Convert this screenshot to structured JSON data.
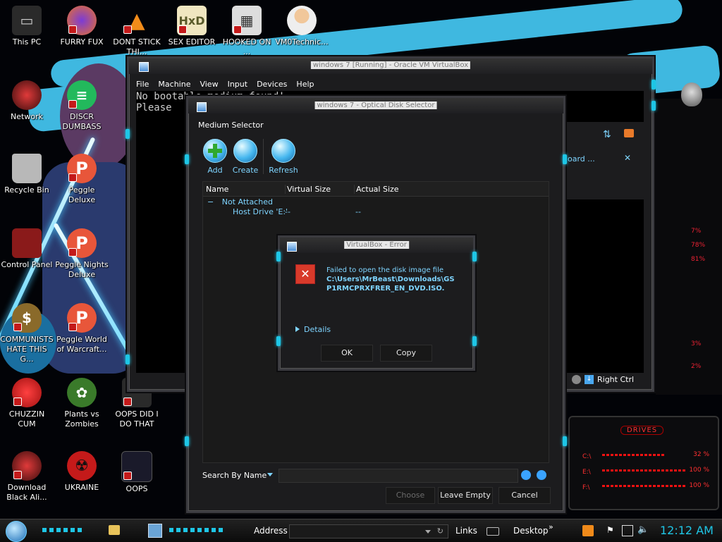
{
  "desktop": {
    "icons": [
      {
        "label": "This PC"
      },
      {
        "label": "FURRY FUX"
      },
      {
        "label": "DONT STICK THI..."
      },
      {
        "label": "SEX EDITOR"
      },
      {
        "label": "HOOKED ON ..."
      },
      {
        "label": "VM0Technic..."
      },
      {
        "label": "Network"
      },
      {
        "label": "DISCR DUMBASS"
      },
      {
        "label": "Recycle Bin"
      },
      {
        "label": "Peggle Deluxe"
      },
      {
        "label": "Control Panel"
      },
      {
        "label": "Peggle Nights Deluxe"
      },
      {
        "label": "COMMUNISTS HATE THIS G..."
      },
      {
        "label": "Peggle World of Warcraft..."
      },
      {
        "label": "CHUZZIN CUM"
      },
      {
        "label": "Plants vs Zombies"
      },
      {
        "label": "OOPS DID I DO THAT"
      },
      {
        "label": "Download Black Ali..."
      },
      {
        "label": "UKRAINE"
      },
      {
        "label": "OOPS"
      }
    ]
  },
  "vm_window": {
    "title": "windows 7 [Running] - Oracle VM VirtualBox",
    "menu": [
      "File",
      "Machine",
      "View",
      "Input",
      "Devices",
      "Help"
    ],
    "console_line1": "No bootable medium found!",
    "console_line2": "Please",
    "host_key": "Right Ctrl",
    "right_snippet": "oard ..."
  },
  "medium_selector": {
    "title": "windows 7 - Optical Disk Selector",
    "heading": "Medium Selector",
    "toolbar": {
      "add": "Add",
      "create": "Create",
      "refresh": "Refresh"
    },
    "columns": [
      "Name",
      "Virtual Size",
      "Actual Size"
    ],
    "group": "Not Attached",
    "group_toggle": "−",
    "row": {
      "name": "Host Drive 'E:'",
      "virtual_size": "--",
      "actual_size": "--"
    },
    "search_label": "Search By Name",
    "buttons": {
      "choose": "Choose",
      "leave_empty": "Leave Empty",
      "cancel": "Cancel"
    }
  },
  "error_dialog": {
    "title": "VirtualBox - Error",
    "message_prefix": "Failed to open the disk image file ",
    "message_path": "C:\\Users\\MrBeast\\Downloads\\GSP1RMCPRXFRER_EN_DVD.ISO.",
    "details": "Details",
    "ok": "OK",
    "copy": "Copy"
  },
  "gadget": {
    "stats": [
      "7%",
      "78%",
      "81%",
      "3%",
      "2%"
    ],
    "drives_title": "DRIVES",
    "drives": [
      {
        "label": "C:\\",
        "value": "32 %"
      },
      {
        "label": "E:\\",
        "value": "100 %"
      },
      {
        "label": "F:\\",
        "value": "100 %"
      }
    ]
  },
  "taskbar": {
    "address_label": "Address",
    "links": "Links",
    "desktop": "Desktop",
    "time": "12:12 AM"
  },
  "colors": {
    "accent_cyan": "#1ec6e6",
    "error_red": "#d83a2a",
    "link_blue": "#7ed4ff"
  }
}
